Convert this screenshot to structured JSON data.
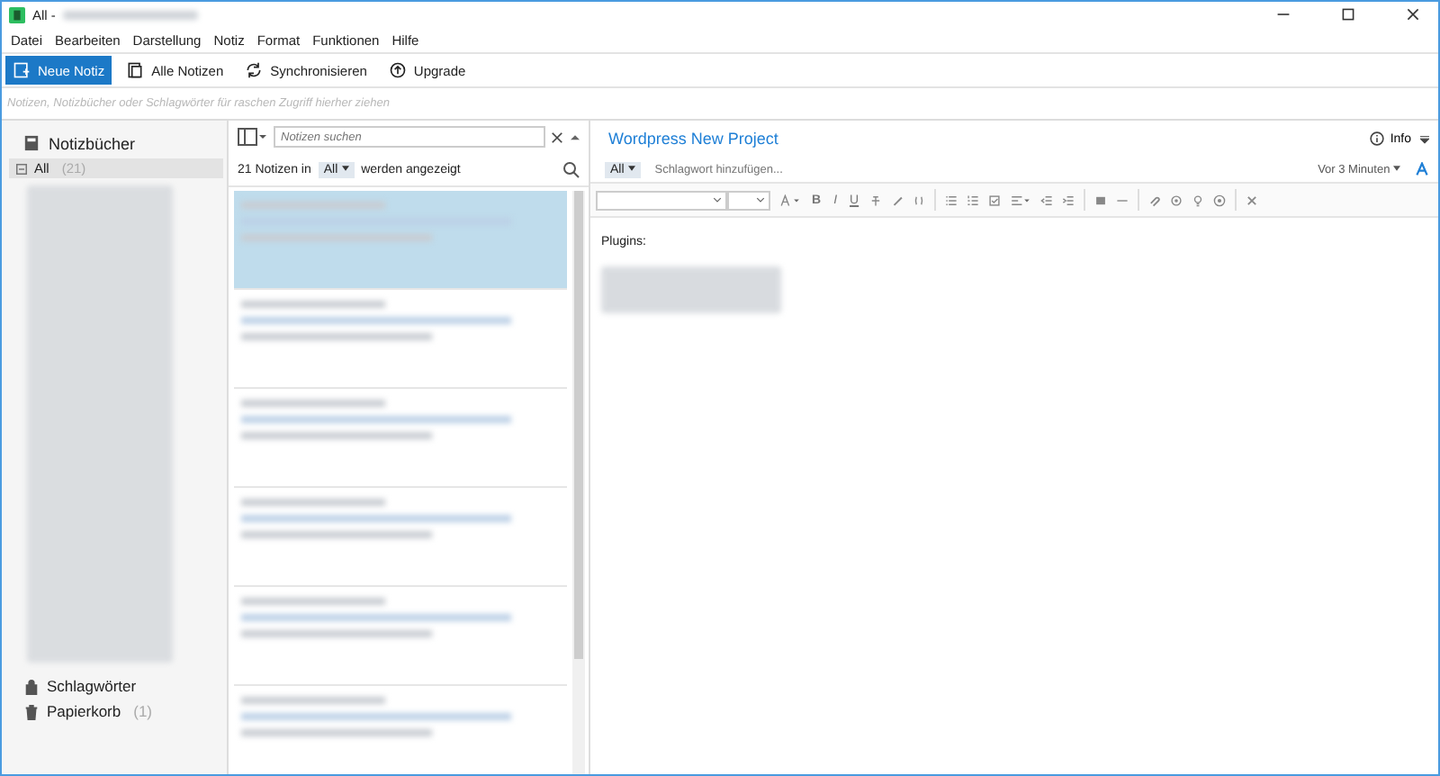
{
  "window": {
    "title": "All -"
  },
  "menu": [
    "Datei",
    "Bearbeiten",
    "Darstellung",
    "Notiz",
    "Format",
    "Funktionen",
    "Hilfe"
  ],
  "toolbar": [
    {
      "kind": "new",
      "label": "Neue Notiz",
      "selected": true
    },
    {
      "kind": "all",
      "label": "Alle Notizen",
      "selected": false
    },
    {
      "kind": "sync",
      "label": "Synchronisieren",
      "selected": false
    },
    {
      "kind": "upgrade",
      "label": "Upgrade",
      "selected": false
    }
  ],
  "shortcut_bar": {
    "placeholder": "Notizen, Notizbücher oder Schlagwörter für raschen Zugriff hierher ziehen"
  },
  "sidebar": {
    "heading": "Notizbücher",
    "all": {
      "label": "All",
      "count": "(21)",
      "selected": true
    },
    "footer": [
      {
        "kind": "tags",
        "label": "Schlagwörter"
      },
      {
        "kind": "trash",
        "label": "Papierkorb",
        "count": "(1)"
      }
    ]
  },
  "note_list": {
    "search": {
      "placeholder": "Notizen suchen"
    },
    "count_text": "21 Notizen in",
    "scope": "All",
    "suffix": "werden angezeigt",
    "notes": [
      {
        "selected": true
      },
      {
        "selected": false
      },
      {
        "selected": false
      },
      {
        "selected": false
      },
      {
        "selected": false
      },
      {
        "selected": false
      }
    ]
  },
  "editor": {
    "title": "Wordpress New Project",
    "info": "Info",
    "notebook": "All",
    "tag_placeholder": "Schlagwort hinzufügen...",
    "modified": "Vor 3 Minuten",
    "format_buttons": [
      {
        "kind": "text",
        "label": "B"
      },
      {
        "kind": "text",
        "label": "I"
      },
      {
        "kind": "text",
        "label": "U"
      }
    ],
    "body_heading": "Plugins:"
  }
}
